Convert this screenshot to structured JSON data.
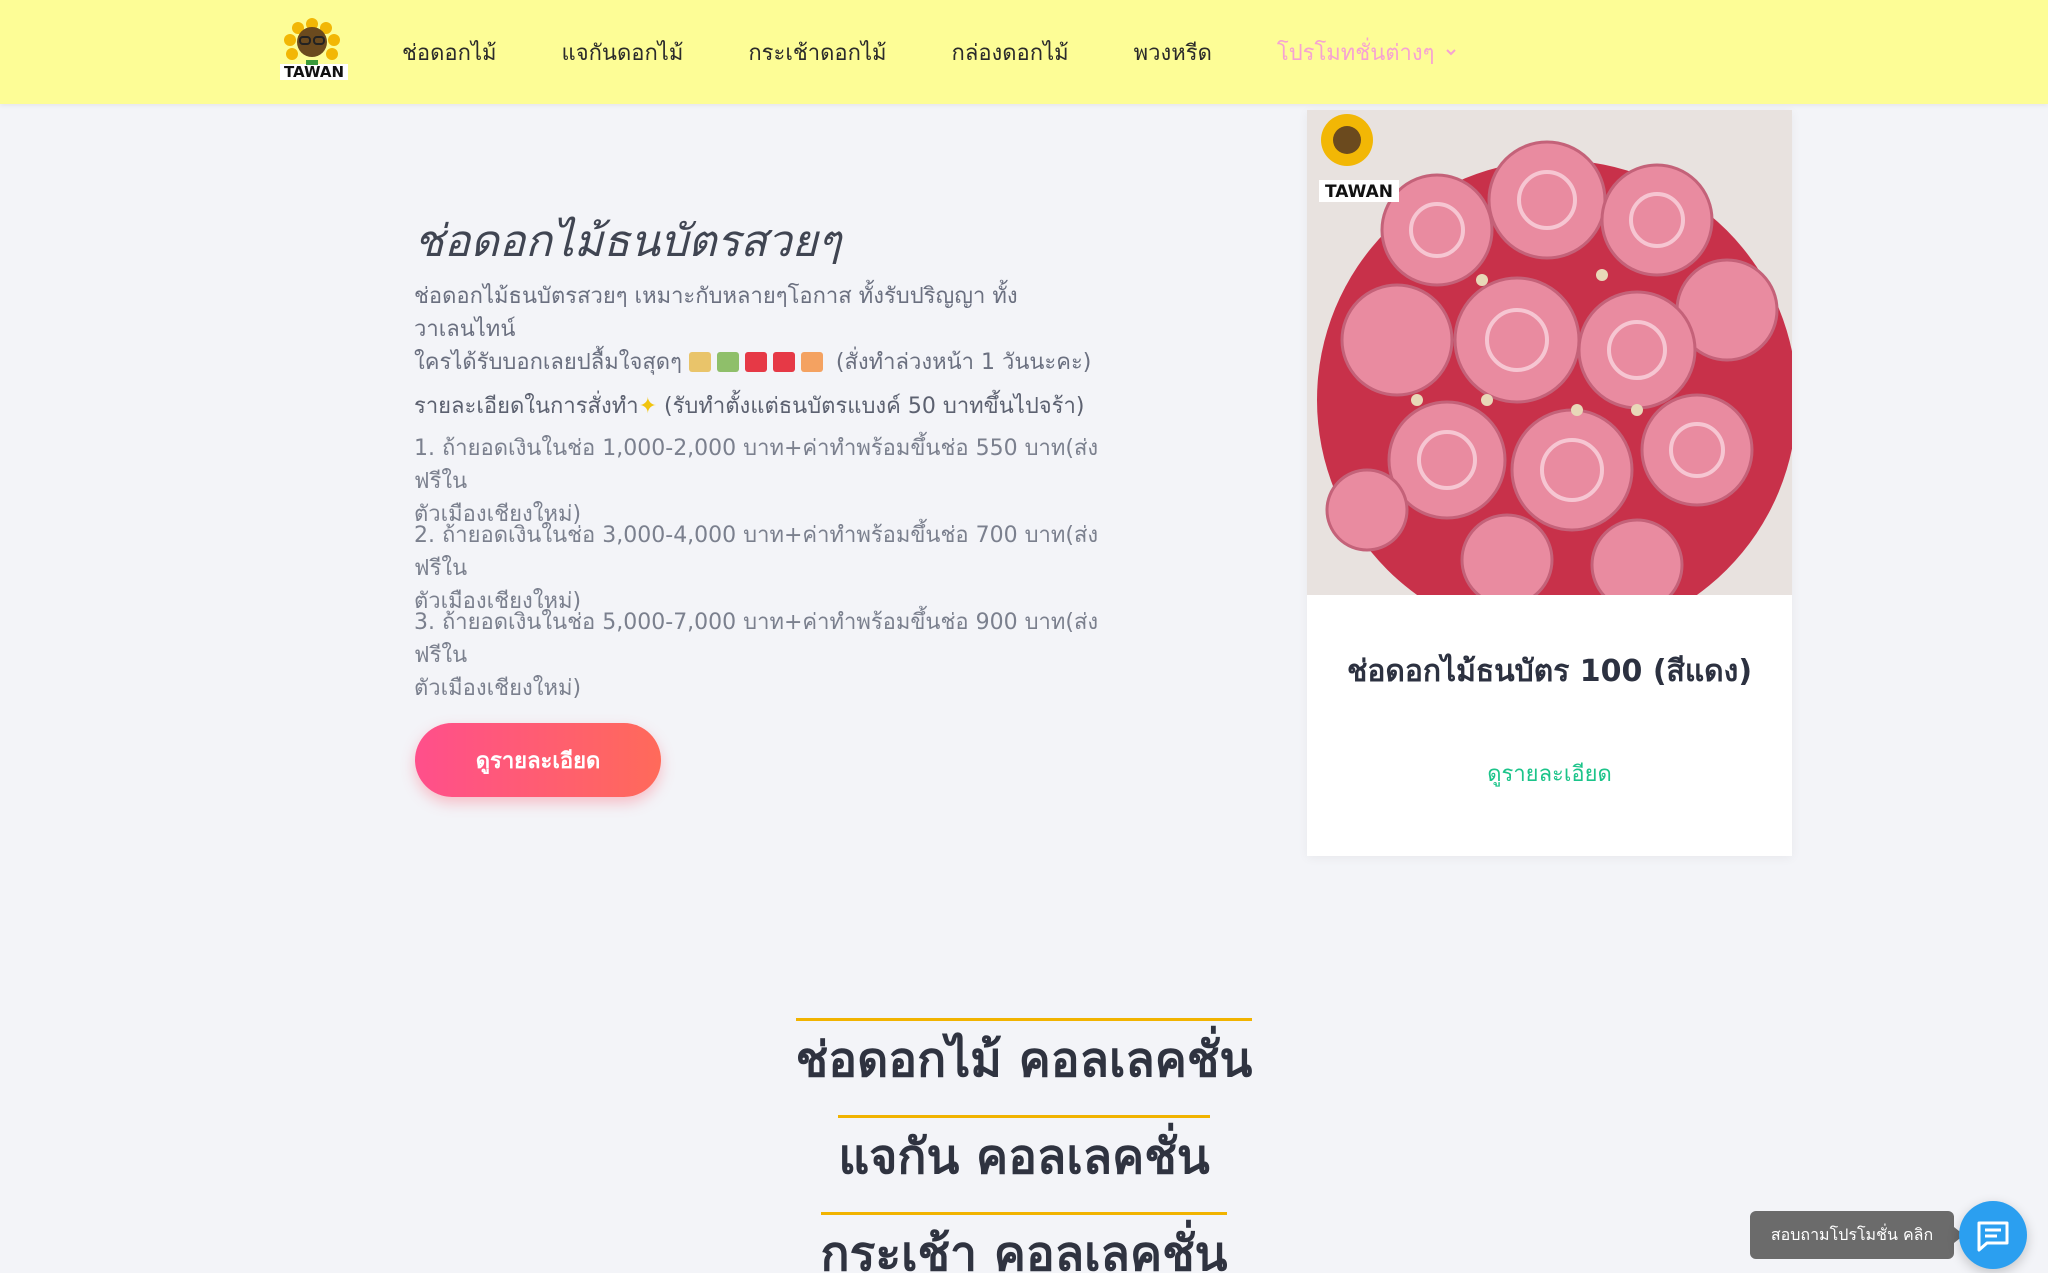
{
  "header": {
    "logo_text": "TAWAN",
    "nav": [
      {
        "label": "ช่อดอกไม้"
      },
      {
        "label": "แจกันดอกไม้"
      },
      {
        "label": "กระเช้าดอกไม้"
      },
      {
        "label": "กล่องดอกไม้"
      },
      {
        "label": "พวงหรีด"
      },
      {
        "label": "โปรโมทชั่นต่างๆ"
      }
    ]
  },
  "product": {
    "title": "ช่อดอกไม้ธนบัตรสวยๆ",
    "desc_line1": "ช่อดอกไม้ธนบัตรสวยๆ เหมาะกับหลายๆโอกาส ทั้งรับปริญญา ทั้งวาเลนไทน์",
    "desc_line2_pre": "ใครได้รับบอกเลยปลื้มใจสุดๆ",
    "desc_line2_post": "(สั่งทำล่วงหน้า 1 วันนะคะ)",
    "details_head_pre": "รายละเอียดในการสั่งทำ",
    "details_head_post": "(รับทำตั้งแต่ธนบัตรแบงค์ 50 บาทขึ้นไปจร้า)",
    "details": [
      {
        "l1": "1. ถ้ายอดเงินในช่อ 1,000-2,000 บาท+ค่าทำพร้อมขึ้นช่อ 550 บาท(ส่งฟรีใน",
        "l2": "ตัวเมืองเชียงใหม่)"
      },
      {
        "l1": "2. ถ้ายอดเงินในช่อ 3,000-4,000 บาท+ค่าทำพร้อมขึ้นช่อ 700 บาท(ส่งฟรีใน",
        "l2": "ตัวเมืองเชียงใหม่)"
      },
      {
        "l1": "3. ถ้ายอดเงินในช่อ 5,000-7,000 บาท+ค่าทำพร้อมขึ้นช่อ 900 บาท(ส่งฟรีใน",
        "l2": "ตัวเมืองเชียงใหม่)"
      }
    ],
    "cta_label": "ดูรายละเอียด"
  },
  "card": {
    "logo_text": "TAWAN",
    "title": "ช่อดอกไม้ธนบัตร 100 (สีแดง)",
    "link_label": "ดูรายละเอียด"
  },
  "collections": [
    {
      "label": "ช่อดอกไม้ คอลเลคชั่น"
    },
    {
      "label": "แจกัน คอลเลคชั่น"
    },
    {
      "label": "กระเช้า คอลเลคชั่น"
    }
  ],
  "chat": {
    "label": "สอบถามโปรโมชั่น คลิก"
  },
  "colors": {
    "header_bg": "#fdfd96",
    "promo": "#f6a3d2",
    "cta_start": "#ff4f8b",
    "cta_end": "#ff6a5a",
    "link_green": "#1cc48a",
    "underline": "#f1b300",
    "chat_blue": "#2b9ff0"
  }
}
